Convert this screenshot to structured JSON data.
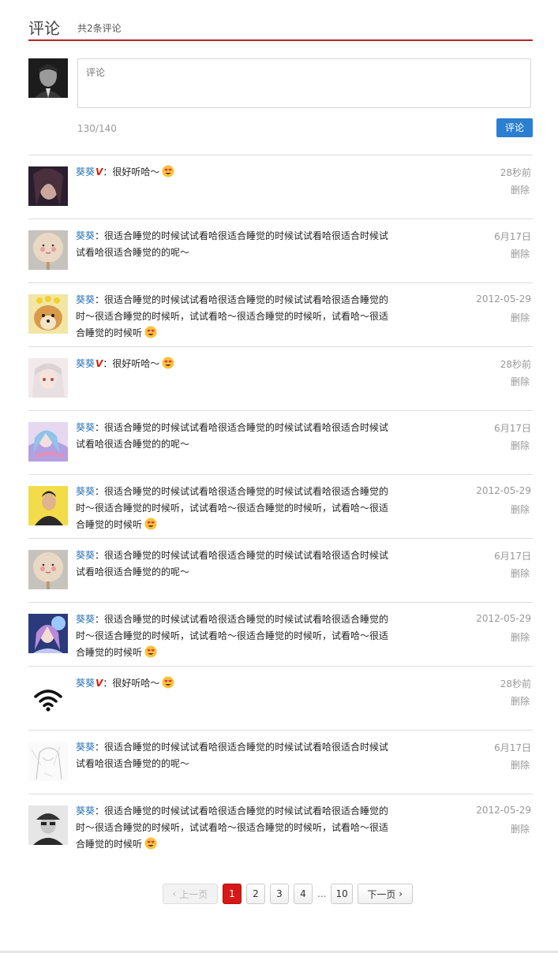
{
  "header": {
    "title": "评论",
    "count_text": "共2条评论"
  },
  "composer": {
    "placeholder": "评论",
    "char_count": "130/140",
    "submit_label": "评论"
  },
  "comments": [
    {
      "user": "葵葵",
      "vip": true,
      "sep": "：",
      "text": "很好听哈～",
      "emoji": true,
      "time": "28秒前",
      "delete": "删除",
      "avatar": "portrait-woman-dark"
    },
    {
      "user": "葵葵",
      "vip": false,
      "sep": "：",
      "text": "很适合睡觉的时候试试看哈很适合睡觉的时候试试看哈很适合时候试试看哈很适合睡觉的的呢～",
      "emoji": false,
      "time": "6月17日",
      "delete": "删除",
      "avatar": "cartoon-face"
    },
    {
      "user": "葵葵",
      "vip": false,
      "sep": "：",
      "text": "很适合睡觉的时候试试看哈很适合睡觉的时候试试看哈很适合睡觉的时～很适合睡觉的时候听，试试看哈～很适合睡觉的时候听，试看哈～很适合睡觉的时候听",
      "emoji": true,
      "time": "2012-05-29",
      "delete": "删除",
      "avatar": "shiba-dog"
    },
    {
      "user": "葵葵",
      "vip": true,
      "sep": "：",
      "text": "很好听哈～",
      "emoji": true,
      "time": "28秒前",
      "delete": "删除",
      "avatar": "anime-girl-white"
    },
    {
      "user": "葵葵",
      "vip": false,
      "sep": "：",
      "text": "很适合睡觉的时候试试看哈很适合睡觉的时候试试看哈很适合时候试试看哈很适合睡觉的的呢～",
      "emoji": false,
      "time": "6月17日",
      "delete": "删除",
      "avatar": "anime-girl-blue"
    },
    {
      "user": "葵葵",
      "vip": false,
      "sep": "：",
      "text": "很适合睡觉的时候试试看哈很适合睡觉的时候试试看哈很适合睡觉的时～很适合睡觉的时候听，试试看哈～很适合睡觉的时候听，试看哈～很适合睡觉的时候听",
      "emoji": true,
      "time": "2012-05-29",
      "delete": "删除",
      "avatar": "man-yellow-bg"
    },
    {
      "user": "葵葵",
      "vip": false,
      "sep": "：",
      "text": "很适合睡觉的时候试试看哈很适合睡觉的时候试试看哈很适合时候试试看哈很适合睡觉的的呢～",
      "emoji": false,
      "time": "6月17日",
      "delete": "删除",
      "avatar": "cartoon-face"
    },
    {
      "user": "葵葵",
      "vip": false,
      "sep": "：",
      "text": "很适合睡觉的时候试试看哈很适合睡觉的时候试试看哈很适合睡觉的时～很适合睡觉的时候听，试试看哈～很适合睡觉的时候听，试看哈～很适合睡觉的时候听",
      "emoji": true,
      "time": "2012-05-29",
      "delete": "删除",
      "avatar": "anime-purple"
    },
    {
      "user": "葵葵",
      "vip": true,
      "sep": "：",
      "text": "很好听哈～",
      "emoji": true,
      "time": "28秒前",
      "delete": "删除",
      "avatar": "wifi-icon"
    },
    {
      "user": "葵葵",
      "vip": false,
      "sep": "：",
      "text": "很适合睡觉的时候试试看哈很适合睡觉的时候试试看哈很适合时候试试看哈很适合睡觉的的呢～",
      "emoji": false,
      "time": "6月17日",
      "delete": "删除",
      "avatar": "sketch-girl"
    },
    {
      "user": "葵葵",
      "vip": false,
      "sep": "：",
      "text": "很适合睡觉的时候试试看哈很适合睡觉的时候试试看哈很适合睡觉的时～很适合睡觉的时候听，试试看哈～很适合睡觉的时候听，试看哈～很适合睡觉的时候听",
      "emoji": true,
      "time": "2012-05-29",
      "delete": "删除",
      "avatar": "bw-person-cap"
    }
  ],
  "vip_mark": "V",
  "pagination": {
    "prev": "上一页",
    "pages": [
      "1",
      "2",
      "3",
      "4"
    ],
    "ellipsis": "...",
    "last": "10",
    "next": "下一页",
    "current": "1"
  },
  "colors": {
    "accent_red": "#b3262b",
    "link_blue": "#2b74b6",
    "button_blue": "#2b7fd1",
    "active_page": "#d71818"
  }
}
